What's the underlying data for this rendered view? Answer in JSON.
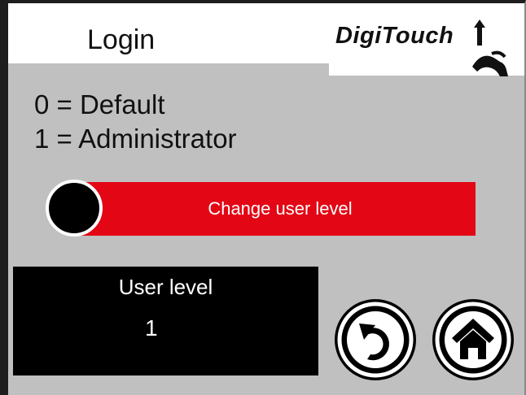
{
  "header": {
    "title": "Login",
    "logo_text": "DigiTouch"
  },
  "legend": {
    "line_default": "0 = Default",
    "line_admin": "1 = Administrator"
  },
  "change_button": {
    "label": "Change user level",
    "color": "#e30615"
  },
  "user_level": {
    "label": "User level",
    "value": "1"
  },
  "nav": {
    "back_icon": "back-arrow-icon",
    "home_icon": "home-icon"
  },
  "colors": {
    "background": "#c0c0c0",
    "accent": "#e30615"
  }
}
